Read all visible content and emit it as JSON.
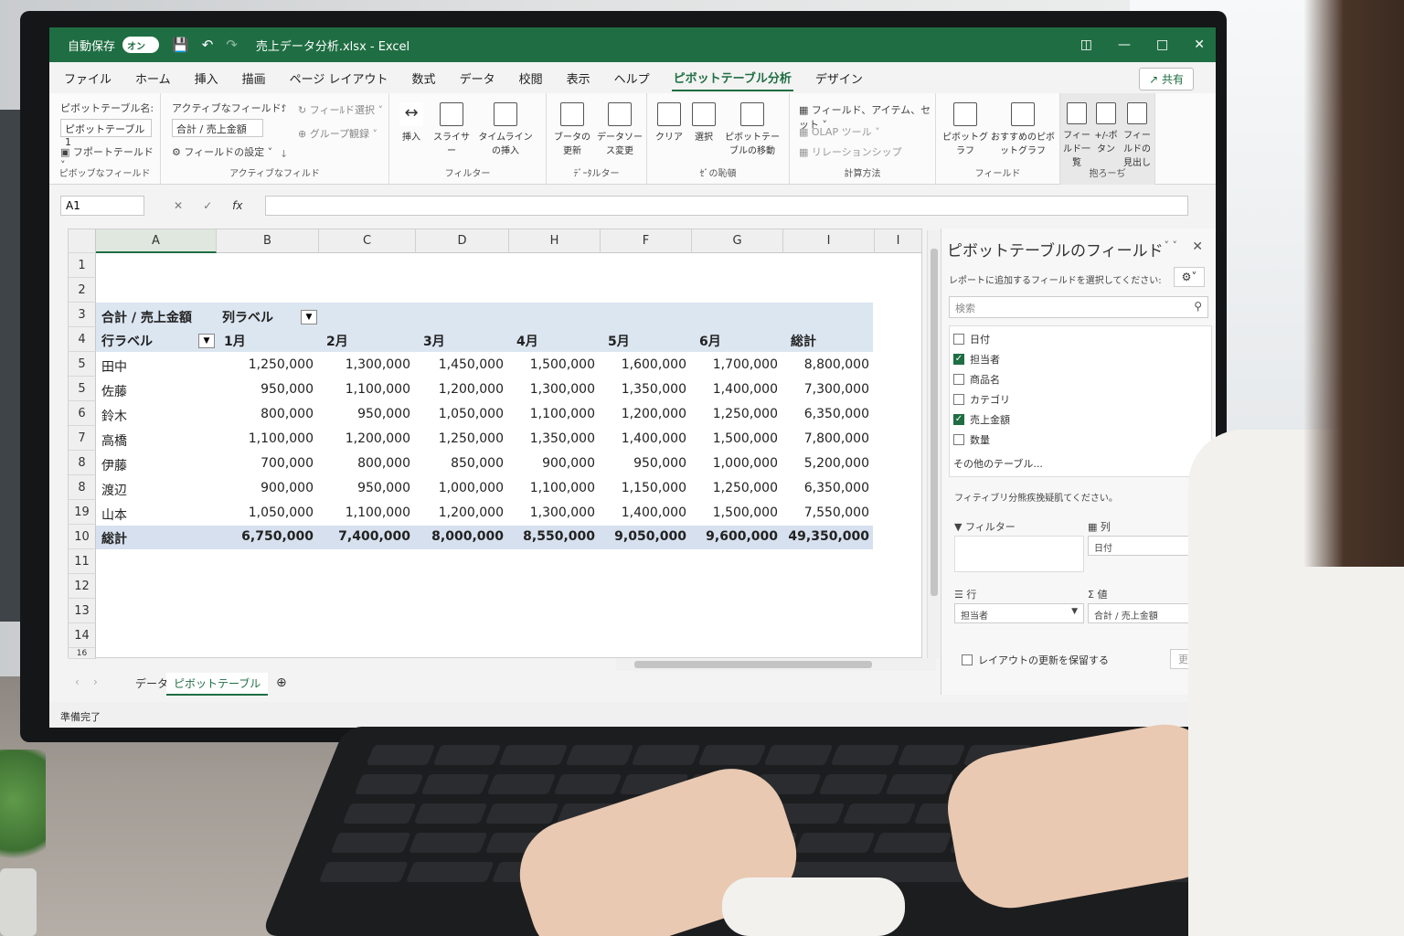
{
  "titlebar": {
    "autosave": "自動保存",
    "toggle": "オン",
    "title": "売上データ分析.xlsx - Excel"
  },
  "menu": {
    "tabs": [
      "ファイル",
      "ホーム",
      "挿入",
      "描画",
      "ページ レイアウト",
      "数式",
      "データ",
      "校閲",
      "表示",
      "ヘルプ",
      "ピボットテーブル分析",
      "デザイン"
    ],
    "share": "共有"
  },
  "ribbon": {
    "pt_name_label": "ピボットテーブル名:",
    "pt_name_value": "ピボットテーブル1",
    "report_filter": "フポートテールド",
    "group1_label": "ピボッブなフィールド",
    "active_field_label": "アクティブなフィールド:",
    "active_field_value": "合計 / 売上金額",
    "field_settings": "フィールドの設定",
    "field_select": "フィーﾙド選択",
    "group_expand": "グループ観録",
    "group2_label": "アクティブなフィルド",
    "btn_insert": "挿入",
    "btn_slicer": "スライサー",
    "btn_timeline": "タイムラインの挿入",
    "group3_label": "フィルター",
    "btn_refresh": "ブータの更新",
    "btn_datasource": "データソース変更",
    "group4_label": "ﾃﾞｰﾀルター",
    "btn_clear": "クリア",
    "btn_select": "選択",
    "btn_move": "ピボットテーブルの移動",
    "group5_label": "ｾﾞの恥頓",
    "calc_fields": "フィールド、アイテム、セット",
    "olap": "OLAP ツール",
    "relations": "リレーションシップ",
    "group6_label": "計算方法",
    "btn_pivotchart": "ピボットグラフ",
    "btn_recommended": "おすすめのピボットグラフ",
    "group7_label": "フィールド",
    "btn_fieldlist": "フィールド一覧",
    "btn_plusminus": "+/-ボタン",
    "btn_headers": "フィールドの見出し",
    "group8_label": "抱ろーぢ"
  },
  "formula": {
    "namebox": "A1",
    "fx": "fx"
  },
  "columns": [
    "A",
    "B",
    "C",
    "D",
    "H",
    "F",
    "G",
    "I",
    "I"
  ],
  "row_headers": [
    "1",
    "2",
    "3",
    "4",
    "5",
    "5",
    "6",
    "7",
    "8",
    "8",
    "19",
    "10",
    "11",
    "12",
    "13",
    "14",
    "16"
  ],
  "pivot": {
    "value_label": "合計 / 売上金額",
    "col_label": "列ラベル",
    "row_label": "行ラベル",
    "months": [
      "1月",
      "2月",
      "3月",
      "4月",
      "5月",
      "6月",
      "総計"
    ],
    "rows": [
      {
        "name": "田中",
        "values": [
          "1,250,000",
          "1,300,000",
          "1,450,000",
          "1,500,000",
          "1,600,000",
          "1,700,000",
          "8,800,000"
        ]
      },
      {
        "name": "佐藤",
        "values": [
          "950,000",
          "1,100,000",
          "1,200,000",
          "1,300,000",
          "1,350,000",
          "1,400,000",
          "7,300,000"
        ]
      },
      {
        "name": "鈴木",
        "values": [
          "800,000",
          "950,000",
          "1,050,000",
          "1,100,000",
          "1,200,000",
          "1,250,000",
          "6,350,000"
        ]
      },
      {
        "name": "高橋",
        "values": [
          "1,100,000",
          "1,200,000",
          "1,250,000",
          "1,350,000",
          "1,400,000",
          "1,500,000",
          "7,800,000"
        ]
      },
      {
        "name": "伊藤",
        "values": [
          "700,000",
          "800,000",
          "850,000",
          "900,000",
          "950,000",
          "1,000,000",
          "5,200,000"
        ]
      },
      {
        "name": "渡辺",
        "values": [
          "900,000",
          "950,000",
          "1,000,000",
          "1,100,000",
          "1,150,000",
          "1,250,000",
          "6,350,000"
        ]
      },
      {
        "name": "山本",
        "values": [
          "1,050,000",
          "1,100,000",
          "1,200,000",
          "1,300,000",
          "1,400,000",
          "1,500,000",
          "7,550,000"
        ]
      }
    ],
    "total": {
      "name": "総計",
      "values": [
        "6,750,000",
        "7,400,000",
        "8,000,000",
        "8,550,000",
        "9,050,000",
        "9,600,000",
        "49,350,000"
      ]
    }
  },
  "sheets": [
    "データ",
    "ピボットテーブル"
  ],
  "status": "準備完了",
  "pane": {
    "title": "ピボットテーブルのフィールド",
    "subtitle": "レポートに追加するフィールドを選択してください:",
    "search_placeholder": "検索",
    "fields": [
      {
        "label": "日付",
        "checked": false
      },
      {
        "label": "担当者",
        "checked": true
      },
      {
        "label": "商品名",
        "checked": false
      },
      {
        "label": "カテゴリ",
        "checked": false
      },
      {
        "label": "売上金額",
        "checked": true
      },
      {
        "label": "数量",
        "checked": false
      }
    ],
    "more_tables": "その他のテーブル...",
    "drag_hint": "フィティブリ分熊疾挽疑肌てください。",
    "area_filter": "フィルター",
    "area_columns": "列",
    "area_columns_value": "日付",
    "area_rows": "行",
    "area_rows_value": "担当者",
    "area_values": "値",
    "area_values_value": "合計 / 売上金額",
    "defer_update": "レイアウトの更新を保留する",
    "update": "更新"
  },
  "colors": {
    "excel_green": "#1f6e43",
    "pivot_band": "#dce6f1"
  }
}
